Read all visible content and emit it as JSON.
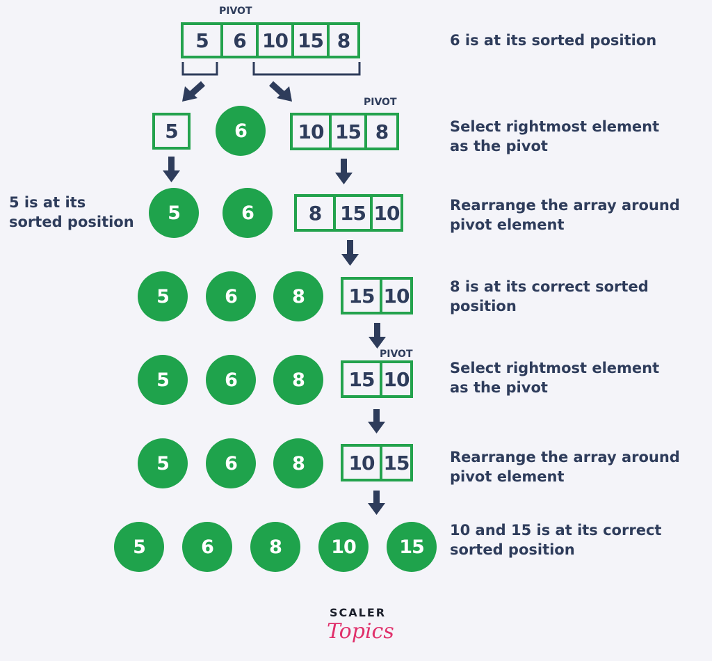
{
  "colors": {
    "green": "#1fa34c",
    "text": "#2e3c5b",
    "background": "#f4f4f9",
    "logo_pink": "#e0306b"
  },
  "pivot_label": "PIVOT",
  "steps": {
    "step1": {
      "array": [
        "5",
        "6",
        "10",
        "15",
        "8"
      ],
      "note": "6 is at its sorted position"
    },
    "step2": {
      "left_array": [
        "5"
      ],
      "sorted": [
        "6"
      ],
      "right_array": [
        "10",
        "15",
        "8"
      ],
      "note": "Select rightmost element\nas the pivot"
    },
    "step3": {
      "sorted": [
        "5",
        "6"
      ],
      "array": [
        "8",
        "15",
        "10"
      ],
      "note": "Rearrange the array around\npivot element",
      "left_note": "5 is at its\nsorted position"
    },
    "step4": {
      "sorted": [
        "5",
        "6",
        "8"
      ],
      "array": [
        "15",
        "10"
      ],
      "note": "8 is at its correct sorted\nposition"
    },
    "step5": {
      "sorted": [
        "5",
        "6",
        "8"
      ],
      "array": [
        "15",
        "10"
      ],
      "note": "Select rightmost element\nas the pivot"
    },
    "step6": {
      "sorted": [
        "5",
        "6",
        "8"
      ],
      "array": [
        "10",
        "15"
      ],
      "note": "Rearrange the array around\npivot element"
    },
    "step7": {
      "sorted": [
        "5",
        "6",
        "8",
        "10",
        "15"
      ],
      "note": "10 and 15 is at its correct\nsorted position"
    }
  },
  "logo": {
    "top": "SCALER",
    "bottom": "Topics"
  }
}
